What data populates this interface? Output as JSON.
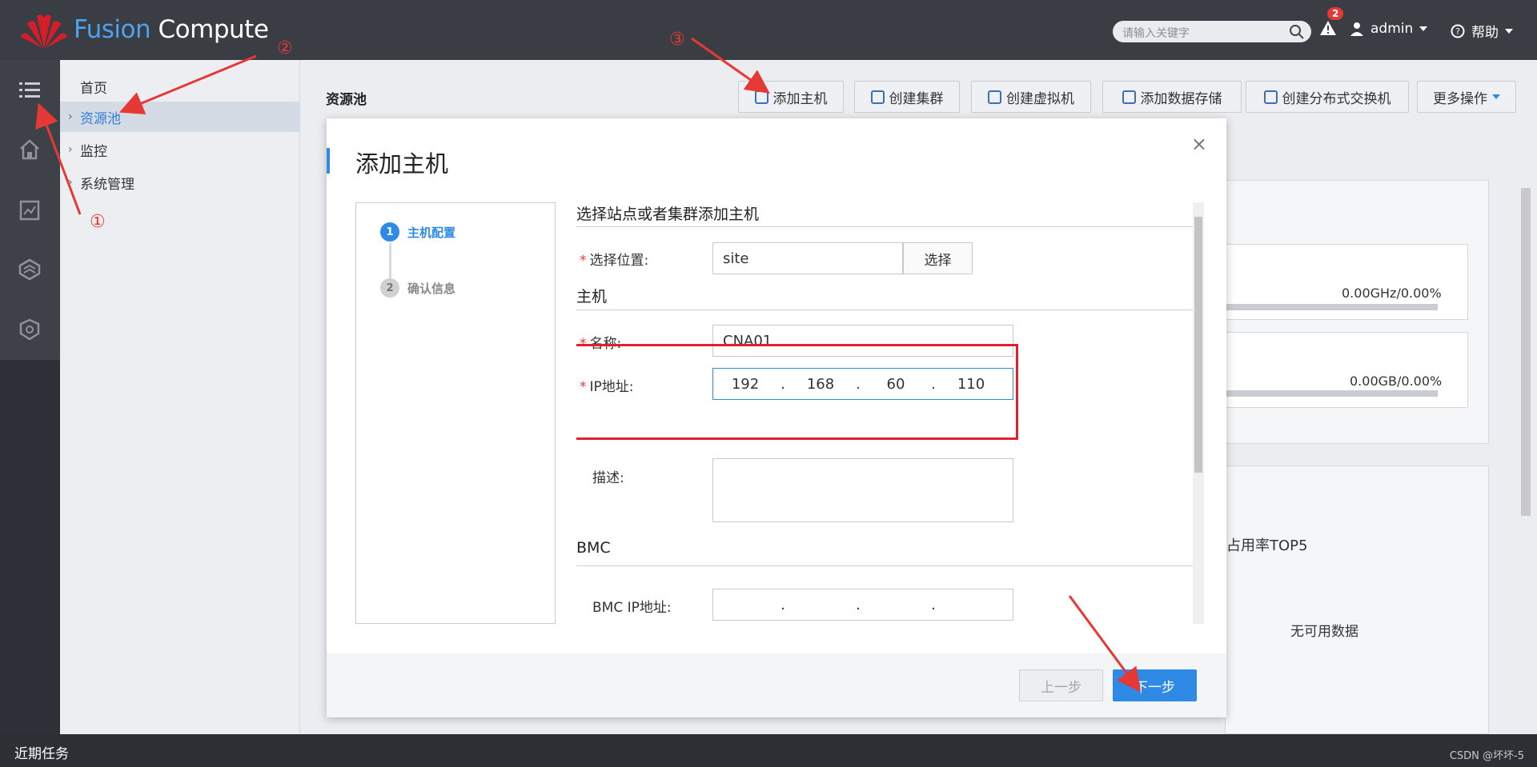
{
  "app": {
    "brand_part1": "Fusion",
    "brand_part2": "Compute"
  },
  "header": {
    "search_placeholder": "请输入关键字",
    "alert_count": "2",
    "user": "admin",
    "help": "帮助"
  },
  "nav": {
    "items": [
      {
        "label": "首页"
      },
      {
        "label": "资源池"
      },
      {
        "label": "监控"
      },
      {
        "label": "系统管理"
      }
    ]
  },
  "page": {
    "title": "资源池",
    "toolbar": [
      "添加主机",
      "创建集群",
      "创建虚拟机",
      "添加数据存储",
      "创建分布式交换机",
      "更多操作"
    ]
  },
  "background": {
    "cpu_value": "0.00GHz/0.00%",
    "mem_value": "0.00GB/0.00%",
    "top5": "占用率TOP5",
    "no_data": "无可用数据"
  },
  "modal": {
    "title": "添加主机",
    "close": "×",
    "steps": [
      {
        "num": "1",
        "label": "主机配置"
      },
      {
        "num": "2",
        "label": "确认信息"
      }
    ],
    "section_location": "选择站点或者集群添加主机",
    "location_label": "选择位置:",
    "location_value": "site",
    "select_button": "选择",
    "section_host": "主机",
    "name_label": "名称:",
    "name_value": "CNA01",
    "ip_label": "IP地址:",
    "ip": [
      "192",
      "168",
      "60",
      "110"
    ],
    "desc_label": "描述:",
    "section_bmc": "BMC",
    "bmc_ip_label": "BMC IP地址:",
    "required_mark": "*",
    "prev_button": "上一步",
    "next_button": "下一步"
  },
  "bottom": {
    "tasks": "近期任务",
    "watermark": "CSDN @坏坏-5"
  },
  "annotations": [
    "①",
    "②",
    "③"
  ],
  "colors": {
    "accent": "#2f8ae5",
    "topbar": "#3b3d44",
    "highlight": "#e0202e"
  }
}
